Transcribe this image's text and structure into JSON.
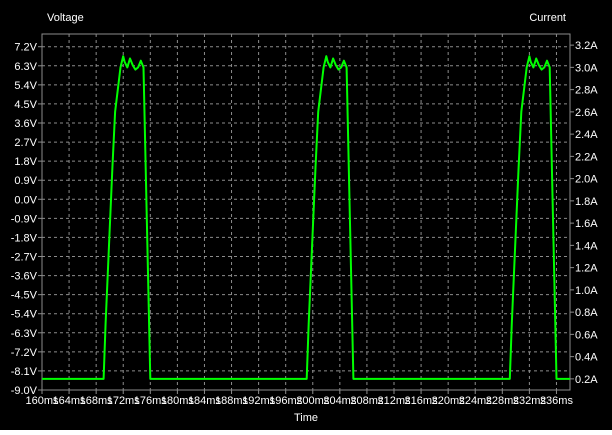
{
  "chart_data": {
    "type": "line",
    "title": "",
    "xlabel": "Time",
    "ylabel_left": "Voltage",
    "ylabel_right": "Current",
    "xlim": [
      160,
      238
    ],
    "ylim_left": [
      -9.0,
      7.8
    ],
    "ylim_right": [
      0.1,
      3.3
    ],
    "grid": true,
    "background": "#000000",
    "trace_color": "#00ff00",
    "x_ticks": [
      {
        "value": 160,
        "label": "160ms"
      },
      {
        "value": 164,
        "label": "164ms"
      },
      {
        "value": 168,
        "label": "168ms"
      },
      {
        "value": 172,
        "label": "172ms"
      },
      {
        "value": 176,
        "label": "176ms"
      },
      {
        "value": 180,
        "label": "180ms"
      },
      {
        "value": 184,
        "label": "184ms"
      },
      {
        "value": 188,
        "label": "188ms"
      },
      {
        "value": 192,
        "label": "192ms"
      },
      {
        "value": 196,
        "label": "196ms"
      },
      {
        "value": 200,
        "label": "200ms"
      },
      {
        "value": 204,
        "label": "204ms"
      },
      {
        "value": 208,
        "label": "208ms"
      },
      {
        "value": 212,
        "label": "212ms"
      },
      {
        "value": 216,
        "label": "216ms"
      },
      {
        "value": 220,
        "label": "220ms"
      },
      {
        "value": 224,
        "label": "224ms"
      },
      {
        "value": 228,
        "label": "228ms"
      },
      {
        "value": 232,
        "label": "232ms"
      },
      {
        "value": 236,
        "label": "236ms"
      }
    ],
    "y_left_ticks": [
      {
        "value": 7.2,
        "label": "7.2V"
      },
      {
        "value": 6.3,
        "label": "6.3V"
      },
      {
        "value": 5.4,
        "label": "5.4V"
      },
      {
        "value": 4.5,
        "label": "4.5V"
      },
      {
        "value": 3.6,
        "label": "3.6V"
      },
      {
        "value": 2.7,
        "label": "2.7V"
      },
      {
        "value": 1.8,
        "label": "1.8V"
      },
      {
        "value": 0.9,
        "label": "0.9V"
      },
      {
        "value": 0.0,
        "label": "0.0V"
      },
      {
        "value": -0.9,
        "label": "-0.9V"
      },
      {
        "value": -1.8,
        "label": "-1.8V"
      },
      {
        "value": -2.7,
        "label": "-2.7V"
      },
      {
        "value": -3.6,
        "label": "-3.6V"
      },
      {
        "value": -4.5,
        "label": "-4.5V"
      },
      {
        "value": -5.4,
        "label": "-5.4V"
      },
      {
        "value": -6.3,
        "label": "-6.3V"
      },
      {
        "value": -7.2,
        "label": "-7.2V"
      },
      {
        "value": -8.1,
        "label": "-8.1V"
      },
      {
        "value": -9.0,
        "label": "-9.0V"
      }
    ],
    "y_right_ticks": [
      {
        "value": 3.2,
        "label": "3.2A"
      },
      {
        "value": 3.0,
        "label": "3.0A"
      },
      {
        "value": 2.8,
        "label": "2.8A"
      },
      {
        "value": 2.6,
        "label": "2.6A"
      },
      {
        "value": 2.4,
        "label": "2.4A"
      },
      {
        "value": 2.2,
        "label": "2.2A"
      },
      {
        "value": 2.0,
        "label": "2.0A"
      },
      {
        "value": 1.8,
        "label": "1.8A"
      },
      {
        "value": 1.6,
        "label": "1.6A"
      },
      {
        "value": 1.4,
        "label": "1.4A"
      },
      {
        "value": 1.2,
        "label": "1.2A"
      },
      {
        "value": 1.0,
        "label": "1.0A"
      },
      {
        "value": 0.8,
        "label": "0.8A"
      },
      {
        "value": 0.6,
        "label": "0.6A"
      },
      {
        "value": 0.4,
        "label": "0.4A"
      },
      {
        "value": 0.2,
        "label": "0.2A"
      }
    ],
    "series": [
      {
        "axis": "right",
        "x": [
          160,
          169.1,
          169.4,
          169.9,
          170.4,
          170.8,
          171.2,
          171.6,
          172.0,
          172.2,
          172.6,
          173.0,
          173.4,
          173.8,
          174.2,
          174.6,
          175.0,
          175.5,
          176.0,
          176.9,
          199.1,
          199.4,
          199.9,
          200.4,
          200.8,
          201.2,
          201.6,
          202.0,
          202.2,
          202.6,
          203.0,
          203.4,
          203.8,
          204.2,
          204.6,
          205.0,
          205.5,
          206.0,
          206.9,
          229.1,
          229.4,
          229.9,
          230.4,
          230.8,
          231.2,
          231.6,
          232.0,
          232.2,
          232.6,
          233.0,
          233.4,
          233.8,
          234.2,
          234.6,
          235.0,
          235.5,
          236.0,
          236.9,
          238
        ],
        "y": [
          0.2,
          0.2,
          0.7,
          1.4,
          2.1,
          2.6,
          2.8,
          3.0,
          3.1,
          3.05,
          3.0,
          3.08,
          3.02,
          2.98,
          3.0,
          3.06,
          3.0,
          1.6,
          0.2,
          0.2,
          0.2,
          0.7,
          1.4,
          2.1,
          2.6,
          2.8,
          3.0,
          3.1,
          3.05,
          3.0,
          3.08,
          3.02,
          2.98,
          3.0,
          3.06,
          3.0,
          1.6,
          0.2,
          0.2,
          0.2,
          0.7,
          1.4,
          2.1,
          2.6,
          2.8,
          3.0,
          3.1,
          3.05,
          3.0,
          3.08,
          3.02,
          2.98,
          3.0,
          3.06,
          3.0,
          1.6,
          0.2,
          0.2,
          0.2
        ]
      }
    ]
  }
}
